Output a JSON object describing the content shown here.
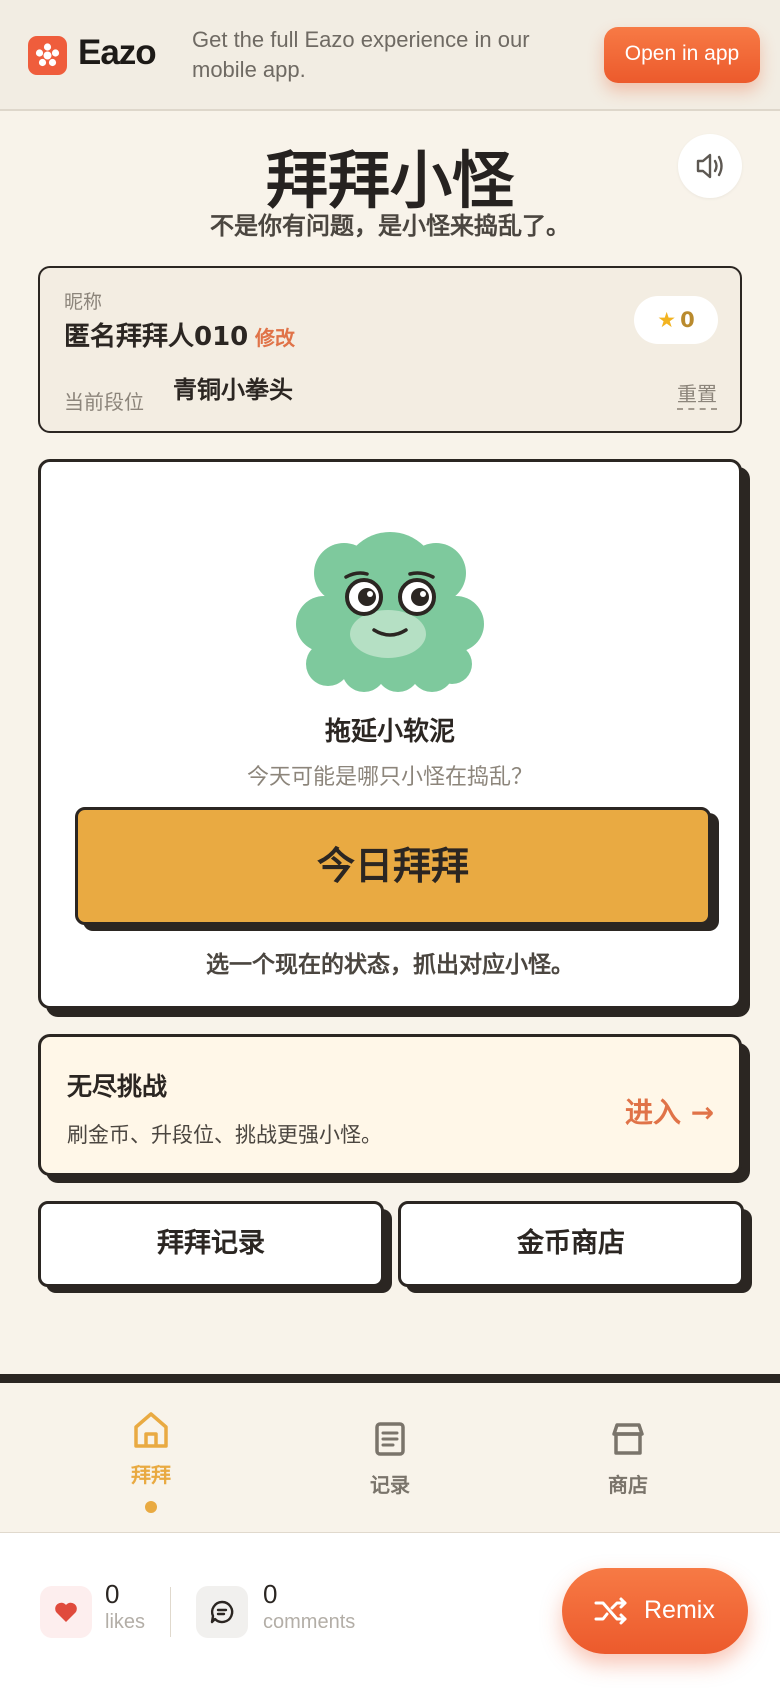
{
  "banner": {
    "brand_name": "Eazo",
    "message": "Get the full Eazo experience in our mobile app.",
    "open_app_label": "Open in app"
  },
  "header": {
    "title": "拜拜小怪",
    "subtitle": "不是你有问题，是小怪来捣乱了。"
  },
  "profile": {
    "nickname_label": "昵称",
    "nickname": "匿名拜拜人010",
    "edit_label": "修改",
    "coins": "0",
    "rank_label": "当前段位",
    "rank_value": "青铜小拳头",
    "reset_label": "重置"
  },
  "monster_card": {
    "monster_name": "拖延小软泥",
    "hint": "今天可能是哪只小怪在捣乱？",
    "pray_button": "今日拜拜",
    "pray_hint": "选一个现在的状态，抓出对应小怪。"
  },
  "endless": {
    "title": "无尽挑战",
    "description": "刷金币、升段位、挑战更强小怪。",
    "enter_label": "进入 →"
  },
  "actions": {
    "records_label": "拜拜记录",
    "shop_label": "金币商店"
  },
  "tabs": [
    {
      "label": "拜拜",
      "icon": "home-icon",
      "active": true
    },
    {
      "label": "记录",
      "icon": "document-icon",
      "active": false
    },
    {
      "label": "商店",
      "icon": "store-icon",
      "active": false
    }
  ],
  "social": {
    "likes_count": "0",
    "likes_label": "likes",
    "comments_count": "0",
    "comments_label": "comments",
    "remix_label": "Remix"
  },
  "colors": {
    "accent_orange": "#ec5a2c",
    "button_yellow": "#e9aa42",
    "monster_green": "#7ec99d",
    "link_orange": "#e07348",
    "background": "#f8f3ea"
  }
}
